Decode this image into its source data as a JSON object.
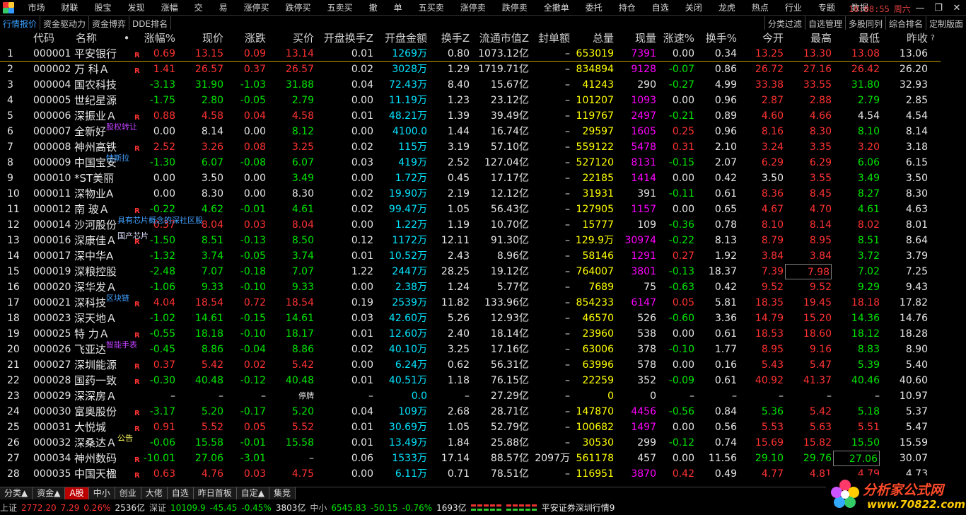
{
  "menu": [
    "市场",
    "财联",
    "股宝",
    "发现",
    "涨幅",
    "交",
    "易",
    "涨停买",
    "跌停买",
    "五卖买",
    "撤",
    "单",
    "五买卖",
    "涨停卖",
    "跌停卖",
    "全撤单",
    "委托",
    "持仓",
    "自选",
    "关闭",
    "龙虎",
    "热点",
    "行业",
    "专题",
    "数据"
  ],
  "clock": {
    "time": "10:08:55",
    "weekday": "周六"
  },
  "tabs_left": [
    "行情报价",
    "资金驱动力",
    "资金博弈",
    "DDE排名"
  ],
  "tabs_right": [
    "分类过滤",
    "自选管理",
    "多股同列",
    "综合排名",
    "定制版面"
  ],
  "columns": [
    "",
    "代码",
    "名称",
    "•",
    "涨幅%",
    "现价",
    "涨跌",
    "买价",
    "开盘换手Z",
    "开盘金额",
    "换手Z",
    "流通市值Z",
    "封单额",
    "总量",
    "现量",
    "涨速%",
    "换手%",
    "今开",
    "最高",
    "最低",
    "昨收"
  ],
  "header_mark": "?",
  "rows": [
    {
      "no": "1",
      "code": "000001",
      "name": "平安银行",
      "r": "R",
      "tag": "",
      "pct": "0.69",
      "price": "13.15",
      "chg": "0.09",
      "bid": "13.14",
      "oturn": "0.01",
      "oamt": "1269万",
      "turnz": "0.80",
      "mcap": "1073.12亿",
      "seal": "–",
      "vol": "653019",
      "cur": "7391",
      "speed": "0.00",
      "turn": "0.34",
      "open": "13.25",
      "high": "13.30",
      "low": "13.08",
      "prev": "13.06",
      "dir": "up"
    },
    {
      "no": "2",
      "code": "000002",
      "name": "万 科Ａ",
      "r": "R",
      "tag": "",
      "pct": "1.41",
      "price": "26.57",
      "chg": "0.37",
      "bid": "26.57",
      "oturn": "0.02",
      "oamt": "3028万",
      "turnz": "1.29",
      "mcap": "1719.71亿",
      "seal": "–",
      "vol": "834894",
      "cur": "9128",
      "speed": "-0.07",
      "turn": "0.86",
      "open": "26.72",
      "high": "27.16",
      "low": "26.42",
      "prev": "26.20",
      "dir": "up"
    },
    {
      "no": "3",
      "code": "000004",
      "name": "国农科技",
      "r": "",
      "tag": "",
      "pct": "-3.13",
      "price": "31.90",
      "chg": "-1.03",
      "bid": "31.88",
      "oturn": "0.04",
      "oamt": "72.43万",
      "turnz": "8.40",
      "mcap": "15.67亿",
      "seal": "–",
      "vol": "41243",
      "cur": "290",
      "speed": "-0.27",
      "turn": "4.99",
      "open": "33.38",
      "high": "33.55",
      "low": "31.80",
      "prev": "32.93",
      "dir": "dn"
    },
    {
      "no": "4",
      "code": "000005",
      "name": "世纪星源",
      "r": "",
      "tag": "",
      "pct": "-1.75",
      "price": "2.80",
      "chg": "-0.05",
      "bid": "2.79",
      "oturn": "0.00",
      "oamt": "11.19万",
      "turnz": "1.23",
      "mcap": "23.12亿",
      "seal": "–",
      "vol": "101207",
      "cur": "1093",
      "speed": "0.00",
      "turn": "0.96",
      "open": "2.87",
      "high": "2.88",
      "low": "2.79",
      "prev": "2.85",
      "dir": "dn"
    },
    {
      "no": "5",
      "code": "000006",
      "name": "深振业Ａ",
      "r": "R",
      "tag": "",
      "pct": "0.88",
      "price": "4.58",
      "chg": "0.04",
      "bid": "4.58",
      "oturn": "0.01",
      "oamt": "48.21万",
      "turnz": "1.39",
      "mcap": "39.49亿",
      "seal": "–",
      "vol": "119767",
      "cur": "2497",
      "speed": "-0.21",
      "turn": "0.89",
      "open": "4.60",
      "high": "4.66",
      "low": "4.54",
      "prev": "4.54",
      "dir": "up"
    },
    {
      "no": "6",
      "code": "000007",
      "name": "全新好",
      "r": "",
      "tag": "股权转让",
      "pct": "0.00",
      "price": "8.14",
      "chg": "0.00",
      "bid": "8.12",
      "oturn": "0.00",
      "oamt": "4100.0",
      "turnz": "1.44",
      "mcap": "16.74亿",
      "seal": "–",
      "vol": "29597",
      "cur": "1605",
      "speed": "0.25",
      "turn": "0.96",
      "open": "8.16",
      "high": "8.30",
      "low": "8.10",
      "prev": "8.14",
      "dir": "flat"
    },
    {
      "no": "7",
      "code": "000008",
      "name": "神州高铁",
      "r": "R",
      "tag": "",
      "pct": "2.52",
      "price": "3.26",
      "chg": "0.08",
      "bid": "3.25",
      "oturn": "0.02",
      "oamt": "115万",
      "turnz": "3.19",
      "mcap": "57.10亿",
      "seal": "–",
      "vol": "559122",
      "cur": "5478",
      "speed": "0.31",
      "turn": "2.10",
      "open": "3.24",
      "high": "3.35",
      "low": "3.20",
      "prev": "3.18",
      "dir": "up"
    },
    {
      "no": "8",
      "code": "000009",
      "name": "中国宝安",
      "r": "",
      "tag": "特斯拉",
      "pct": "-1.30",
      "price": "6.07",
      "chg": "-0.08",
      "bid": "6.07",
      "oturn": "0.03",
      "oamt": "419万",
      "turnz": "2.52",
      "mcap": "127.04亿",
      "seal": "–",
      "vol": "527120",
      "cur": "8131",
      "speed": "-0.15",
      "turn": "2.07",
      "open": "6.29",
      "high": "6.29",
      "low": "6.06",
      "prev": "6.15",
      "dir": "dn"
    },
    {
      "no": "9",
      "code": "000010",
      "name": "*ST美丽",
      "r": "",
      "tag": "",
      "pct": "0.00",
      "price": "3.50",
      "chg": "0.00",
      "bid": "3.49",
      "oturn": "0.00",
      "oamt": "1.72万",
      "turnz": "0.45",
      "mcap": "17.17亿",
      "seal": "–",
      "vol": "22185",
      "cur": "1414",
      "speed": "0.00",
      "turn": "0.42",
      "open": "3.50",
      "high": "3.55",
      "low": "3.49",
      "prev": "3.50",
      "dir": "flat"
    },
    {
      "no": "10",
      "code": "000011",
      "name": "深物业A",
      "r": "",
      "tag": "",
      "pct": "0.00",
      "price": "8.30",
      "chg": "0.00",
      "bid": "8.30",
      "oturn": "0.02",
      "oamt": "19.90万",
      "turnz": "2.19",
      "mcap": "12.12亿",
      "seal": "–",
      "vol": "31931",
      "cur": "391",
      "speed": "-0.11",
      "turn": "0.61",
      "open": "8.36",
      "high": "8.45",
      "low": "8.27",
      "prev": "8.30",
      "dir": "flat"
    },
    {
      "no": "11",
      "code": "000012",
      "name": "南 玻Ａ",
      "r": "R",
      "tag": "",
      "pct": "-0.22",
      "price": "4.62",
      "chg": "-0.01",
      "bid": "4.61",
      "oturn": "0.02",
      "oamt": "99.47万",
      "turnz": "1.05",
      "mcap": "56.43亿",
      "seal": "–",
      "vol": "127905",
      "cur": "1157",
      "speed": "0.00",
      "turn": "0.65",
      "open": "4.67",
      "high": "4.70",
      "low": "4.61",
      "prev": "4.63",
      "dir": "dn"
    },
    {
      "no": "12",
      "code": "000014",
      "name": "沙河股份",
      "r": "",
      "tag": "具有芯片概念的深社区股",
      "pct": "0.37",
      "price": "8.04",
      "chg": "0.03",
      "bid": "8.04",
      "oturn": "0.00",
      "oamt": "1.22万",
      "turnz": "1.19",
      "mcap": "10.70亿",
      "seal": "–",
      "vol": "15777",
      "cur": "109",
      "speed": "-0.36",
      "turn": "0.78",
      "open": "8.10",
      "high": "8.14",
      "low": "8.02",
      "prev": "8.01",
      "dir": "up"
    },
    {
      "no": "13",
      "code": "000016",
      "name": "深康佳Ａ",
      "r": "R",
      "tag": "国产芯片",
      "pct": "-1.50",
      "price": "8.51",
      "chg": "-0.13",
      "bid": "8.50",
      "oturn": "0.12",
      "oamt": "1172万",
      "turnz": "12.11",
      "mcap": "91.30亿",
      "seal": "–",
      "vol": "129.9万",
      "cur": "30974",
      "speed": "-0.22",
      "turn": "8.13",
      "open": "8.79",
      "high": "8.95",
      "low": "8.51",
      "prev": "8.64",
      "dir": "dn"
    },
    {
      "no": "14",
      "code": "000017",
      "name": "深中华A",
      "r": "",
      "tag": "",
      "pct": "-1.32",
      "price": "3.74",
      "chg": "-0.05",
      "bid": "3.74",
      "oturn": "0.01",
      "oamt": "10.52万",
      "turnz": "2.43",
      "mcap": "8.96亿",
      "seal": "–",
      "vol": "58146",
      "cur": "1291",
      "speed": "0.27",
      "turn": "1.92",
      "open": "3.84",
      "high": "3.84",
      "low": "3.72",
      "prev": "3.79",
      "dir": "dn"
    },
    {
      "no": "15",
      "code": "000019",
      "name": "深粮控股",
      "r": "",
      "tag": "",
      "pct": "-2.48",
      "price": "7.07",
      "chg": "-0.18",
      "bid": "7.07",
      "oturn": "1.22",
      "oamt": "2447万",
      "turnz": "28.25",
      "mcap": "19.12亿",
      "seal": "–",
      "vol": "764007",
      "cur": "3801",
      "speed": "-0.13",
      "turn": "18.37",
      "open": "7.39",
      "high": "7.98",
      "low": "7.02",
      "prev": "7.25",
      "dir": "dn",
      "boxed": "high"
    },
    {
      "no": "16",
      "code": "000020",
      "name": "深华发Ａ",
      "r": "",
      "tag": "",
      "pct": "-1.06",
      "price": "9.33",
      "chg": "-0.10",
      "bid": "9.33",
      "oturn": "0.00",
      "oamt": "2.38万",
      "turnz": "1.24",
      "mcap": "5.77亿",
      "seal": "–",
      "vol": "7689",
      "cur": "75",
      "speed": "-0.63",
      "turn": "0.42",
      "open": "9.52",
      "high": "9.52",
      "low": "9.29",
      "prev": "9.43",
      "dir": "dn"
    },
    {
      "no": "17",
      "code": "000021",
      "name": "深科技",
      "r": "R",
      "tag": "区块链",
      "pct": "4.04",
      "price": "18.54",
      "chg": "0.72",
      "bid": "18.54",
      "oturn": "0.19",
      "oamt": "2539万",
      "turnz": "11.82",
      "mcap": "133.96亿",
      "seal": "–",
      "vol": "854233",
      "cur": "6147",
      "speed": "0.05",
      "turn": "5.81",
      "open": "18.35",
      "high": "19.45",
      "low": "18.18",
      "prev": "17.82",
      "dir": "up"
    },
    {
      "no": "18",
      "code": "000023",
      "name": "深天地Ａ",
      "r": "",
      "tag": "",
      "pct": "-1.02",
      "price": "14.61",
      "chg": "-0.15",
      "bid": "14.61",
      "oturn": "0.03",
      "oamt": "42.60万",
      "turnz": "5.26",
      "mcap": "12.93亿",
      "seal": "–",
      "vol": "46570",
      "cur": "526",
      "speed": "-0.60",
      "turn": "3.36",
      "open": "14.79",
      "high": "15.20",
      "low": "14.36",
      "prev": "14.76",
      "dir": "dn"
    },
    {
      "no": "19",
      "code": "000025",
      "name": "特 力Ａ",
      "r": "R",
      "tag": "",
      "pct": "-0.55",
      "price": "18.18",
      "chg": "-0.10",
      "bid": "18.17",
      "oturn": "0.01",
      "oamt": "12.60万",
      "turnz": "2.40",
      "mcap": "18.14亿",
      "seal": "–",
      "vol": "23960",
      "cur": "538",
      "speed": "0.00",
      "turn": "0.61",
      "open": "18.53",
      "high": "18.60",
      "low": "18.12",
      "prev": "18.28",
      "dir": "dn"
    },
    {
      "no": "20",
      "code": "000026",
      "name": "飞亚达",
      "r": "",
      "tag": "智能手表",
      "pct": "-0.45",
      "price": "8.86",
      "chg": "-0.04",
      "bid": "8.86",
      "oturn": "0.02",
      "oamt": "40.10万",
      "turnz": "3.25",
      "mcap": "17.16亿",
      "seal": "–",
      "vol": "63006",
      "cur": "378",
      "speed": "-0.10",
      "turn": "1.77",
      "open": "8.95",
      "high": "9.16",
      "low": "8.83",
      "prev": "8.90",
      "dir": "dn"
    },
    {
      "no": "21",
      "code": "000027",
      "name": "深圳能源",
      "r": "R",
      "tag": "",
      "pct": "0.37",
      "price": "5.42",
      "chg": "0.02",
      "bid": "5.42",
      "oturn": "0.00",
      "oamt": "6.24万",
      "turnz": "0.62",
      "mcap": "56.31亿",
      "seal": "–",
      "vol": "63996",
      "cur": "578",
      "speed": "0.00",
      "turn": "0.16",
      "open": "5.43",
      "high": "5.47",
      "low": "5.39",
      "prev": "5.40",
      "dir": "up"
    },
    {
      "no": "22",
      "code": "000028",
      "name": "国药一致",
      "r": "R",
      "tag": "",
      "pct": "-0.30",
      "price": "40.48",
      "chg": "-0.12",
      "bid": "40.48",
      "oturn": "0.01",
      "oamt": "40.51万",
      "turnz": "1.18",
      "mcap": "76.15亿",
      "seal": "–",
      "vol": "22259",
      "cur": "352",
      "speed": "-0.09",
      "turn": "0.61",
      "open": "40.92",
      "high": "41.37",
      "low": "40.46",
      "prev": "40.60",
      "dir": "dn"
    },
    {
      "no": "23",
      "code": "000029",
      "name": "深深房Ａ",
      "r": "",
      "tag": "",
      "pct": "–",
      "price": "–",
      "chg": "–",
      "bid": "停牌",
      "oturn": "–",
      "oamt": "0.0",
      "turnz": "–",
      "mcap": "27.29亿",
      "seal": "–",
      "vol": "0",
      "cur": "0",
      "speed": "–",
      "turn": "–",
      "open": "–",
      "high": "–",
      "low": "–",
      "prev": "10.97",
      "dir": "halt"
    },
    {
      "no": "24",
      "code": "000030",
      "name": "富奥股份",
      "r": "R",
      "tag": "",
      "pct": "-3.17",
      "price": "5.20",
      "chg": "-0.17",
      "bid": "5.20",
      "oturn": "0.04",
      "oamt": "109万",
      "turnz": "2.68",
      "mcap": "28.71亿",
      "seal": "–",
      "vol": "147870",
      "cur": "4456",
      "speed": "-0.56",
      "turn": "0.84",
      "open": "5.36",
      "high": "5.42",
      "low": "5.18",
      "prev": "5.37",
      "dir": "dn"
    },
    {
      "no": "25",
      "code": "000031",
      "name": "大悦城",
      "r": "R",
      "tag": "",
      "pct": "0.91",
      "price": "5.52",
      "chg": "0.05",
      "bid": "5.52",
      "oturn": "0.01",
      "oamt": "30.69万",
      "turnz": "1.05",
      "mcap": "52.79亿",
      "seal": "–",
      "vol": "100682",
      "cur": "1497",
      "speed": "0.00",
      "turn": "0.56",
      "open": "5.53",
      "high": "5.63",
      "low": "5.51",
      "prev": "5.47",
      "dir": "up"
    },
    {
      "no": "26",
      "code": "000032",
      "name": "深桑达Ａ",
      "r": "",
      "tag": "公告",
      "pct": "-0.06",
      "price": "15.58",
      "chg": "-0.01",
      "bid": "15.58",
      "oturn": "0.01",
      "oamt": "13.49万",
      "turnz": "1.84",
      "mcap": "25.88亿",
      "seal": "–",
      "vol": "30530",
      "cur": "299",
      "speed": "-0.12",
      "turn": "0.74",
      "open": "15.69",
      "high": "15.82",
      "low": "15.50",
      "prev": "15.59",
      "dir": "dn"
    },
    {
      "no": "27",
      "code": "000034",
      "name": "神州数码",
      "r": "R",
      "tag": "",
      "pct": "-10.01",
      "price": "27.06",
      "chg": "-3.01",
      "bid": "–",
      "oturn": "0.06",
      "oamt": "1533万",
      "turnz": "17.14",
      "mcap": "88.57亿",
      "seal": "2097万",
      "vol": "561178",
      "cur": "457",
      "speed": "0.00",
      "turn": "11.56",
      "open": "29.10",
      "high": "29.76",
      "low": "27.06",
      "prev": "30.07",
      "dir": "dn",
      "boxed": "low"
    },
    {
      "no": "28",
      "code": "000035",
      "name": "中国天楹",
      "r": "R",
      "tag": "",
      "pct": "0.63",
      "price": "4.76",
      "chg": "0.03",
      "bid": "4.75",
      "oturn": "0.00",
      "oamt": "6.11万",
      "turnz": "0.71",
      "mcap": "78.51亿",
      "seal": "–",
      "vol": "116951",
      "cur": "3870",
      "speed": "0.42",
      "turn": "0.49",
      "open": "4.77",
      "high": "4.81",
      "low": "4.79",
      "prev": "4.73",
      "dir": "up"
    }
  ],
  "bottom_tabs": [
    "分类▲",
    "资金▲",
    "A股",
    "中小",
    "创业",
    "大佬",
    "自选",
    "昨日首板",
    "自定▲",
    "集竞"
  ],
  "status": {
    "sh_label": "上证",
    "sh_val": "2772.20",
    "sh_chg": "7.29",
    "sh_pct": "0.26%",
    "sh_amt": "2536亿",
    "sz_label": "深证",
    "sz_val": "10109.9",
    "sz_chg": "-45.45",
    "sz_pct": "-0.45%",
    "sz_amt": "3803亿",
    "zx_label": "中小",
    "zx_val": "6545.83",
    "zx_chg": "-50.15",
    "zx_pct": "-0.76%",
    "zx_amt": "1693亿",
    "feed": "平安证券深圳行情9"
  },
  "brand": {
    "title": "分析家公式网",
    "url": "www.70822.com"
  }
}
